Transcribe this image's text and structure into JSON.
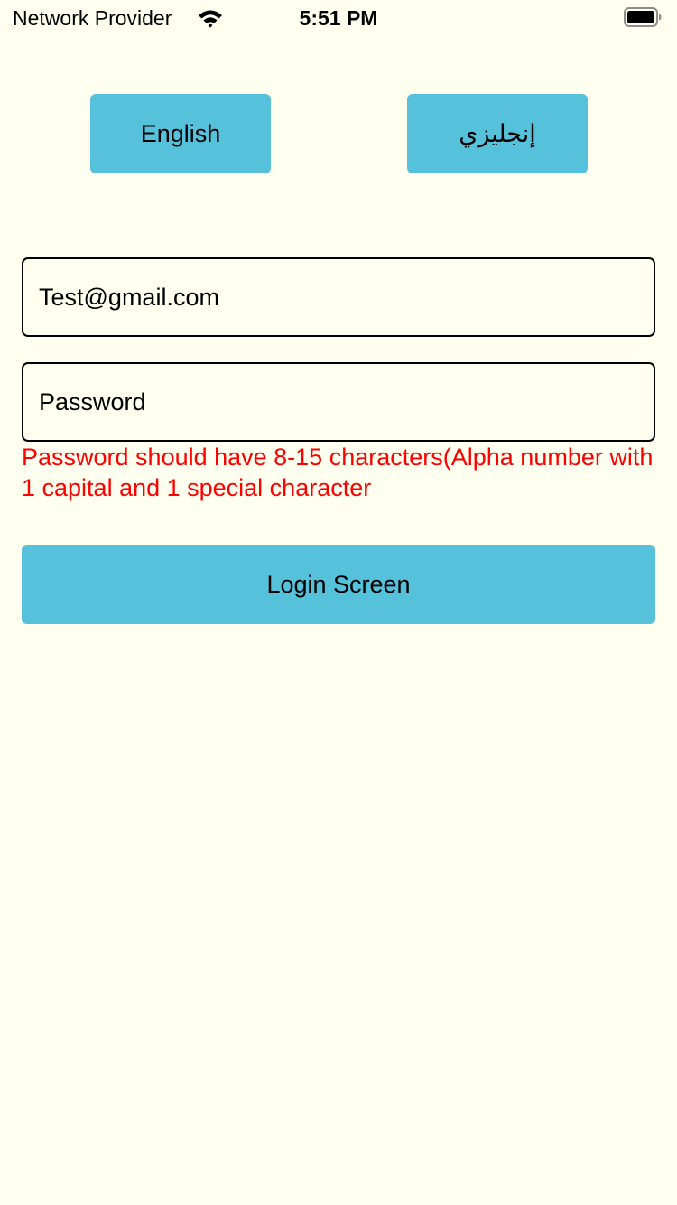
{
  "status_bar": {
    "carrier": "Network Provider",
    "time": "5:51 PM",
    "wifi_icon": "wifi-icon",
    "battery_icon": "battery-icon"
  },
  "language": {
    "english_label": "English",
    "arabic_label": "إنجليزي"
  },
  "form": {
    "email_value": "Test@gmail.com",
    "password_placeholder": "Password",
    "password_error": "Password should have 8-15 characters(Alpha number with 1 capital and 1 special character",
    "login_label": "Login Screen"
  },
  "colors": {
    "background": "#fffff0",
    "button": "#56c1db",
    "error": "#ff0000"
  }
}
